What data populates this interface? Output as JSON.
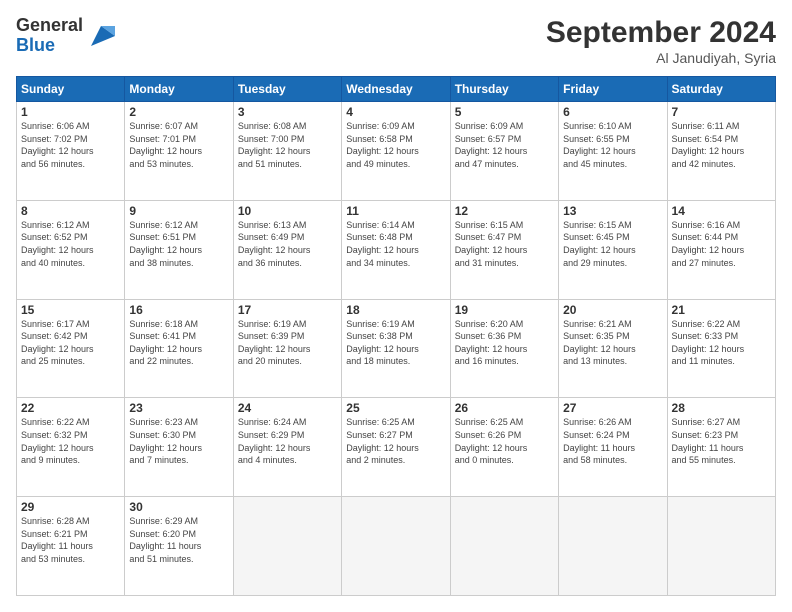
{
  "header": {
    "logo_line1": "General",
    "logo_line2": "Blue",
    "month_title": "September 2024",
    "subtitle": "Al Janudiyah, Syria"
  },
  "weekdays": [
    "Sunday",
    "Monday",
    "Tuesday",
    "Wednesday",
    "Thursday",
    "Friday",
    "Saturday"
  ],
  "weeks": [
    [
      {
        "day": 1,
        "rise": "6:06 AM",
        "set": "7:02 PM",
        "hours": 12,
        "mins": 56
      },
      {
        "day": 2,
        "rise": "6:07 AM",
        "set": "7:01 PM",
        "hours": 12,
        "mins": 53
      },
      {
        "day": 3,
        "rise": "6:08 AM",
        "set": "7:00 PM",
        "hours": 12,
        "mins": 51
      },
      {
        "day": 4,
        "rise": "6:09 AM",
        "set": "6:58 PM",
        "hours": 12,
        "mins": 49
      },
      {
        "day": 5,
        "rise": "6:09 AM",
        "set": "6:57 PM",
        "hours": 12,
        "mins": 47
      },
      {
        "day": 6,
        "rise": "6:10 AM",
        "set": "6:55 PM",
        "hours": 12,
        "mins": 45
      },
      {
        "day": 7,
        "rise": "6:11 AM",
        "set": "6:54 PM",
        "hours": 12,
        "mins": 42
      }
    ],
    [
      {
        "day": 8,
        "rise": "6:12 AM",
        "set": "6:52 PM",
        "hours": 12,
        "mins": 40
      },
      {
        "day": 9,
        "rise": "6:12 AM",
        "set": "6:51 PM",
        "hours": 12,
        "mins": 38
      },
      {
        "day": 10,
        "rise": "6:13 AM",
        "set": "6:49 PM",
        "hours": 12,
        "mins": 36
      },
      {
        "day": 11,
        "rise": "6:14 AM",
        "set": "6:48 PM",
        "hours": 12,
        "mins": 34
      },
      {
        "day": 12,
        "rise": "6:15 AM",
        "set": "6:47 PM",
        "hours": 12,
        "mins": 31
      },
      {
        "day": 13,
        "rise": "6:15 AM",
        "set": "6:45 PM",
        "hours": 12,
        "mins": 29
      },
      {
        "day": 14,
        "rise": "6:16 AM",
        "set": "6:44 PM",
        "hours": 12,
        "mins": 27
      }
    ],
    [
      {
        "day": 15,
        "rise": "6:17 AM",
        "set": "6:42 PM",
        "hours": 12,
        "mins": 25
      },
      {
        "day": 16,
        "rise": "6:18 AM",
        "set": "6:41 PM",
        "hours": 12,
        "mins": 22
      },
      {
        "day": 17,
        "rise": "6:19 AM",
        "set": "6:39 PM",
        "hours": 12,
        "mins": 20
      },
      {
        "day": 18,
        "rise": "6:19 AM",
        "set": "6:38 PM",
        "hours": 12,
        "mins": 18
      },
      {
        "day": 19,
        "rise": "6:20 AM",
        "set": "6:36 PM",
        "hours": 12,
        "mins": 16
      },
      {
        "day": 20,
        "rise": "6:21 AM",
        "set": "6:35 PM",
        "hours": 12,
        "mins": 13
      },
      {
        "day": 21,
        "rise": "6:22 AM",
        "set": "6:33 PM",
        "hours": 12,
        "mins": 11
      }
    ],
    [
      {
        "day": 22,
        "rise": "6:22 AM",
        "set": "6:32 PM",
        "hours": 12,
        "mins": 9
      },
      {
        "day": 23,
        "rise": "6:23 AM",
        "set": "6:30 PM",
        "hours": 12,
        "mins": 7
      },
      {
        "day": 24,
        "rise": "6:24 AM",
        "set": "6:29 PM",
        "hours": 12,
        "mins": 4
      },
      {
        "day": 25,
        "rise": "6:25 AM",
        "set": "6:27 PM",
        "hours": 12,
        "mins": 2
      },
      {
        "day": 26,
        "rise": "6:25 AM",
        "set": "6:26 PM",
        "hours": 12,
        "mins": 0
      },
      {
        "day": 27,
        "rise": "6:26 AM",
        "set": "6:24 PM",
        "hours": 11,
        "mins": 58
      },
      {
        "day": 28,
        "rise": "6:27 AM",
        "set": "6:23 PM",
        "hours": 11,
        "mins": 55
      }
    ],
    [
      {
        "day": 29,
        "rise": "6:28 AM",
        "set": "6:21 PM",
        "hours": 11,
        "mins": 53
      },
      {
        "day": 30,
        "rise": "6:29 AM",
        "set": "6:20 PM",
        "hours": 11,
        "mins": 51
      },
      null,
      null,
      null,
      null,
      null
    ]
  ]
}
